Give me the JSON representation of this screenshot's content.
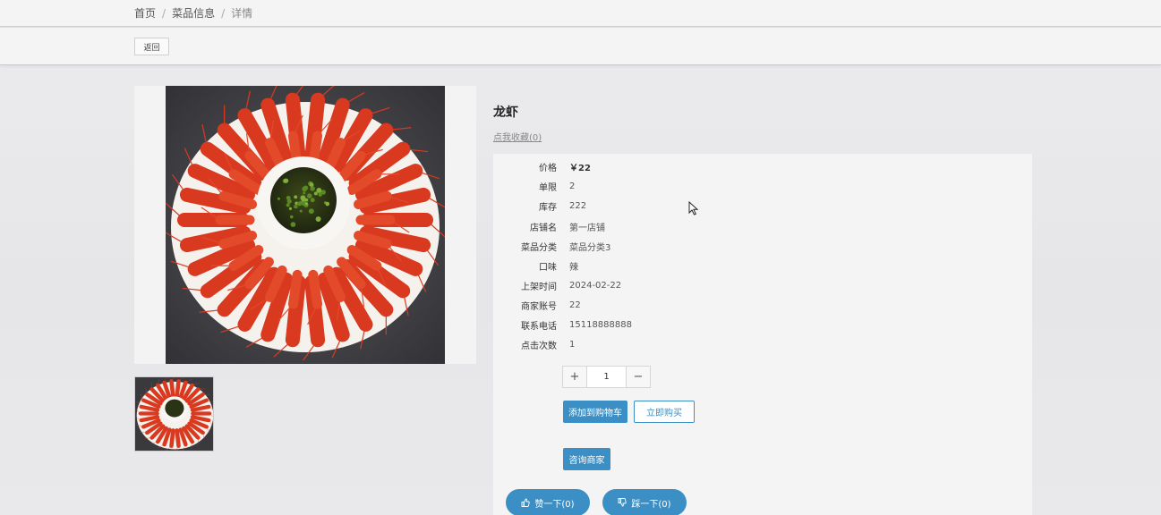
{
  "breadcrumb": {
    "home": "首页",
    "section": "菜品信息",
    "current": "详情",
    "separator": "/"
  },
  "toolbar": {
    "back_label": "返回"
  },
  "product": {
    "title": "龙虾",
    "favorite_link": "点我收藏(0)",
    "details": [
      {
        "label": "价格",
        "value": "￥22"
      },
      {
        "label": "单限",
        "value": "2"
      },
      {
        "label": "库存",
        "value": "222"
      },
      {
        "label": "店铺名",
        "value": "第一店铺"
      },
      {
        "label": "菜品分类",
        "value": "菜品分类3"
      },
      {
        "label": "口味",
        "value": "辣"
      },
      {
        "label": "上架时间",
        "value": "2024-02-22"
      },
      {
        "label": "商家账号",
        "value": "22"
      },
      {
        "label": "联系电话",
        "value": "15118888888"
      },
      {
        "label": "点击次数",
        "value": "1"
      }
    ]
  },
  "quantity": {
    "plus": "+",
    "value": "1",
    "minus": "−"
  },
  "actions": {
    "add_to_cart": "添加到购物车",
    "buy_now": "立即购买",
    "contact_merchant": "咨询商家",
    "like": "赞一下(0)",
    "dislike": "踩一下(0)"
  },
  "colors": {
    "accent": "#3b8fc4",
    "crayfish": "#d9391f",
    "plate": "#f5f2ee",
    "background": "#e6e6e8"
  },
  "icons": {
    "like": "thumbs-up-icon",
    "dislike": "thumbs-down-icon",
    "cursor": "mouse-cursor-icon"
  }
}
